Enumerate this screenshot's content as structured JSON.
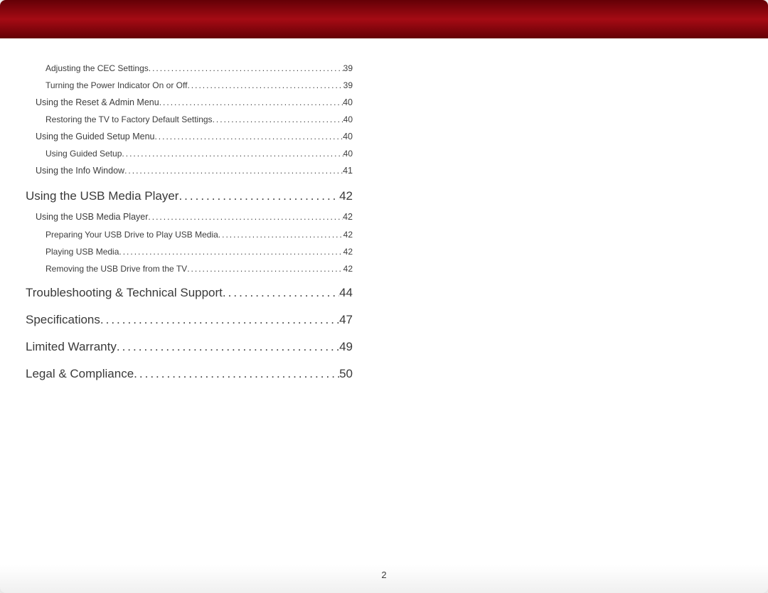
{
  "page_number": "2",
  "toc": [
    {
      "level": 3,
      "title": "Adjusting the CEC Settings",
      "page": "39"
    },
    {
      "level": 3,
      "title": "Turning the Power Indicator On or Off",
      "page": "39"
    },
    {
      "level": 2,
      "title": "Using the Reset & Admin Menu",
      "page": "40"
    },
    {
      "level": 3,
      "title": "Restoring the TV to Factory Default Settings",
      "page": "40"
    },
    {
      "level": 2,
      "title": "Using the Guided Setup Menu",
      "page": "40"
    },
    {
      "level": 3,
      "title": "Using Guided Setup",
      "page": "40"
    },
    {
      "level": 2,
      "title": "Using the Info Window",
      "page": "41"
    },
    {
      "level": 1,
      "title": "Using the USB Media Player",
      "page": "42"
    },
    {
      "level": 2,
      "title": "Using the USB Media Player",
      "page": "42"
    },
    {
      "level": 3,
      "title": "Preparing Your USB Drive to Play USB Media",
      "page": "42"
    },
    {
      "level": 3,
      "title": "Playing USB Media",
      "page": "42"
    },
    {
      "level": 3,
      "title": "Removing the USB Drive from the TV",
      "page": "42"
    },
    {
      "level": 1,
      "title": "Troubleshooting & Technical Support",
      "page": "44"
    },
    {
      "level": 1,
      "title": "Specifications",
      "page": "47"
    },
    {
      "level": 1,
      "title": "Limited Warranty",
      "page": "49"
    },
    {
      "level": 1,
      "title": "Legal & Compliance",
      "page": "50"
    }
  ]
}
